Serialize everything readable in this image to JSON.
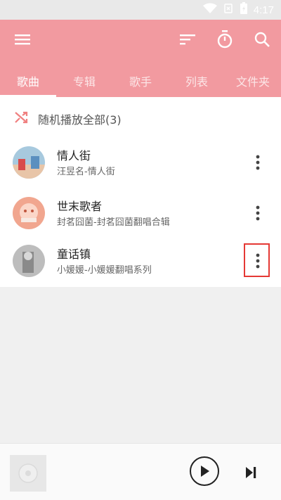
{
  "status_bar": {
    "time": "4:17",
    "icons": [
      "wifi-icon",
      "no-sim-icon",
      "battery-charging-icon"
    ]
  },
  "toolbar": {
    "icons": [
      "menu-icon",
      "sort-icon",
      "timer-icon",
      "search-icon"
    ],
    "background": "#f29aa0"
  },
  "tabs": [
    {
      "label": "歌曲",
      "active": true
    },
    {
      "label": "专辑",
      "active": false
    },
    {
      "label": "歌手",
      "active": false
    },
    {
      "label": "列表",
      "active": false
    },
    {
      "label": "文件夹",
      "active": false
    }
  ],
  "shuffle": {
    "label": "随机播放全部(3)",
    "icon": "shuffle-icon"
  },
  "songs": [
    {
      "title": "情人街",
      "subtitle": "汪昱名-情人街",
      "cover": "album-cover-1"
    },
    {
      "title": "世末歌者",
      "subtitle": "封茗囧菌-封茗囧菌翻唱合辑",
      "cover": "album-cover-2"
    },
    {
      "title": "童话镇",
      "subtitle": "小媛媛-小媛媛翻唱系列",
      "cover": "album-cover-3",
      "more_highlighted": true
    }
  ],
  "player": {
    "icons": [
      "disc-icon",
      "play-icon",
      "skip-next-icon"
    ]
  }
}
